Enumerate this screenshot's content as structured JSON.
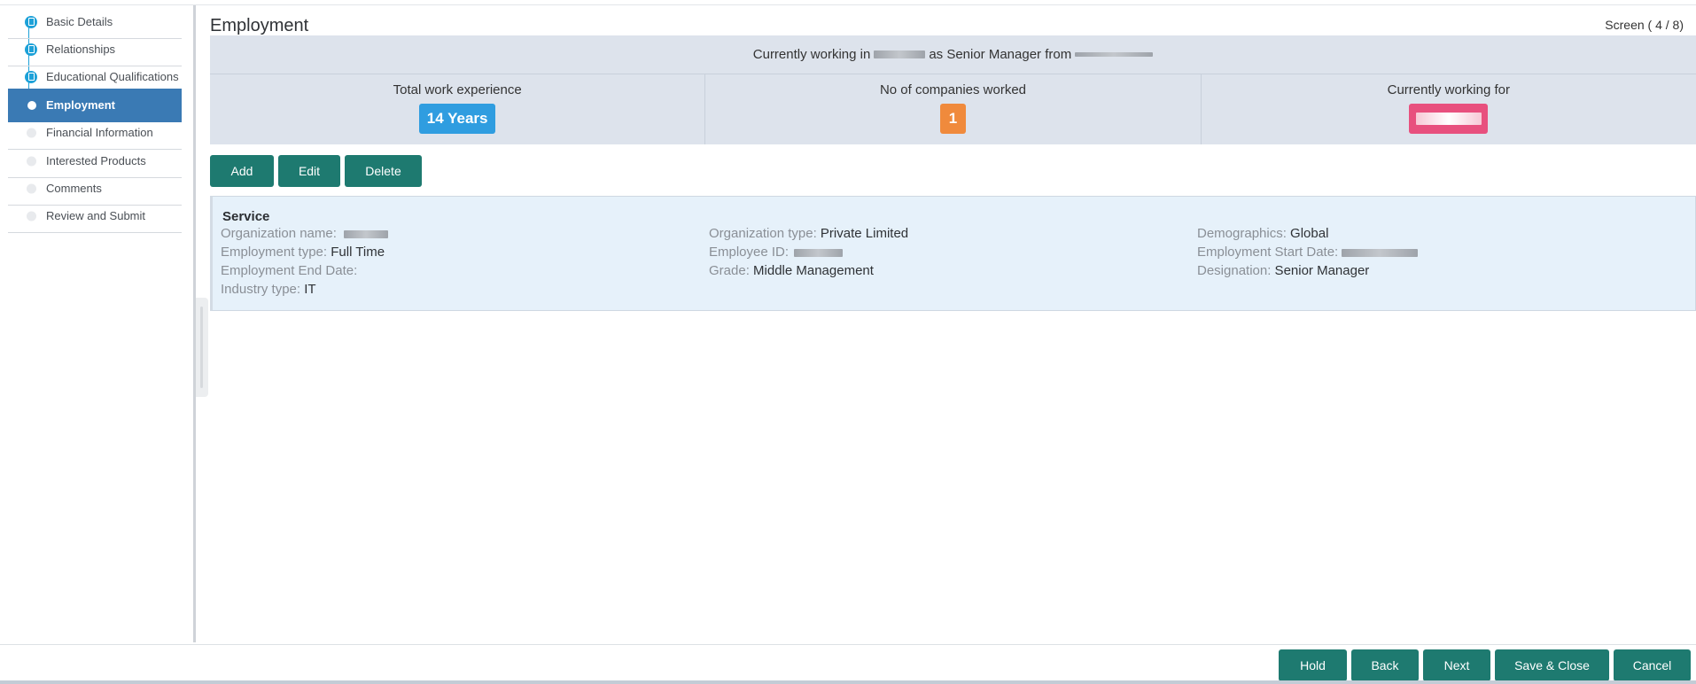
{
  "steps": [
    {
      "label": "Basic Details",
      "state": "done"
    },
    {
      "label": "Relationships",
      "state": "done"
    },
    {
      "label": "Educational Qualifications",
      "state": "done"
    },
    {
      "label": "Employment",
      "state": "current"
    },
    {
      "label": "Financial Information",
      "state": "todo"
    },
    {
      "label": "Interested Products",
      "state": "todo"
    },
    {
      "label": "Comments",
      "state": "todo"
    },
    {
      "label": "Review and Submit",
      "state": "todo"
    }
  ],
  "page": {
    "title": "Employment",
    "screen_indicator": "Screen ( 4 / 8)"
  },
  "summary": {
    "prefix": "Currently working in",
    "middle": "as Senior Manager from",
    "stats": [
      {
        "caption": "Total work experience",
        "value": "14 Years",
        "color": "#2f9de0"
      },
      {
        "caption": "No of companies worked",
        "value": "1",
        "color": "#f08a3c"
      },
      {
        "caption": "Currently working for",
        "value": "",
        "color": "#e8507e"
      }
    ]
  },
  "actions": {
    "add": "Add",
    "edit": "Edit",
    "delete": "Delete"
  },
  "record": {
    "title": "Service",
    "fields": {
      "org_name": {
        "label": "Organization name:",
        "value": ""
      },
      "emp_type": {
        "label": "Employment type:",
        "value": " Full Time"
      },
      "end_date": {
        "label": "Employment End Date:",
        "value": ""
      },
      "industry": {
        "label": "Industry type:",
        "value": " IT"
      },
      "org_type": {
        "label": "Organization type:",
        "value": " Private Limited"
      },
      "emp_id": {
        "label": "Employee ID:",
        "value": ""
      },
      "grade": {
        "label": "Grade:",
        "value": " Middle Management"
      },
      "demographics": {
        "label": "Demographics:",
        "value": " Global"
      },
      "start_date": {
        "label": "Employment Start Date:",
        "value": ""
      },
      "designation": {
        "label": "Designation:",
        "value": " Senior Manager"
      }
    }
  },
  "footer": {
    "hold": "Hold",
    "back": "Back",
    "next": "Next",
    "save_close": "Save & Close",
    "cancel": "Cancel"
  },
  "colors": {
    "primary_button": "#1e7a70",
    "active_step": "#3a7ab4",
    "step_done": "#1da1d8",
    "summary_bg": "#dde3ec",
    "card_bg": "#e6f1fa"
  }
}
